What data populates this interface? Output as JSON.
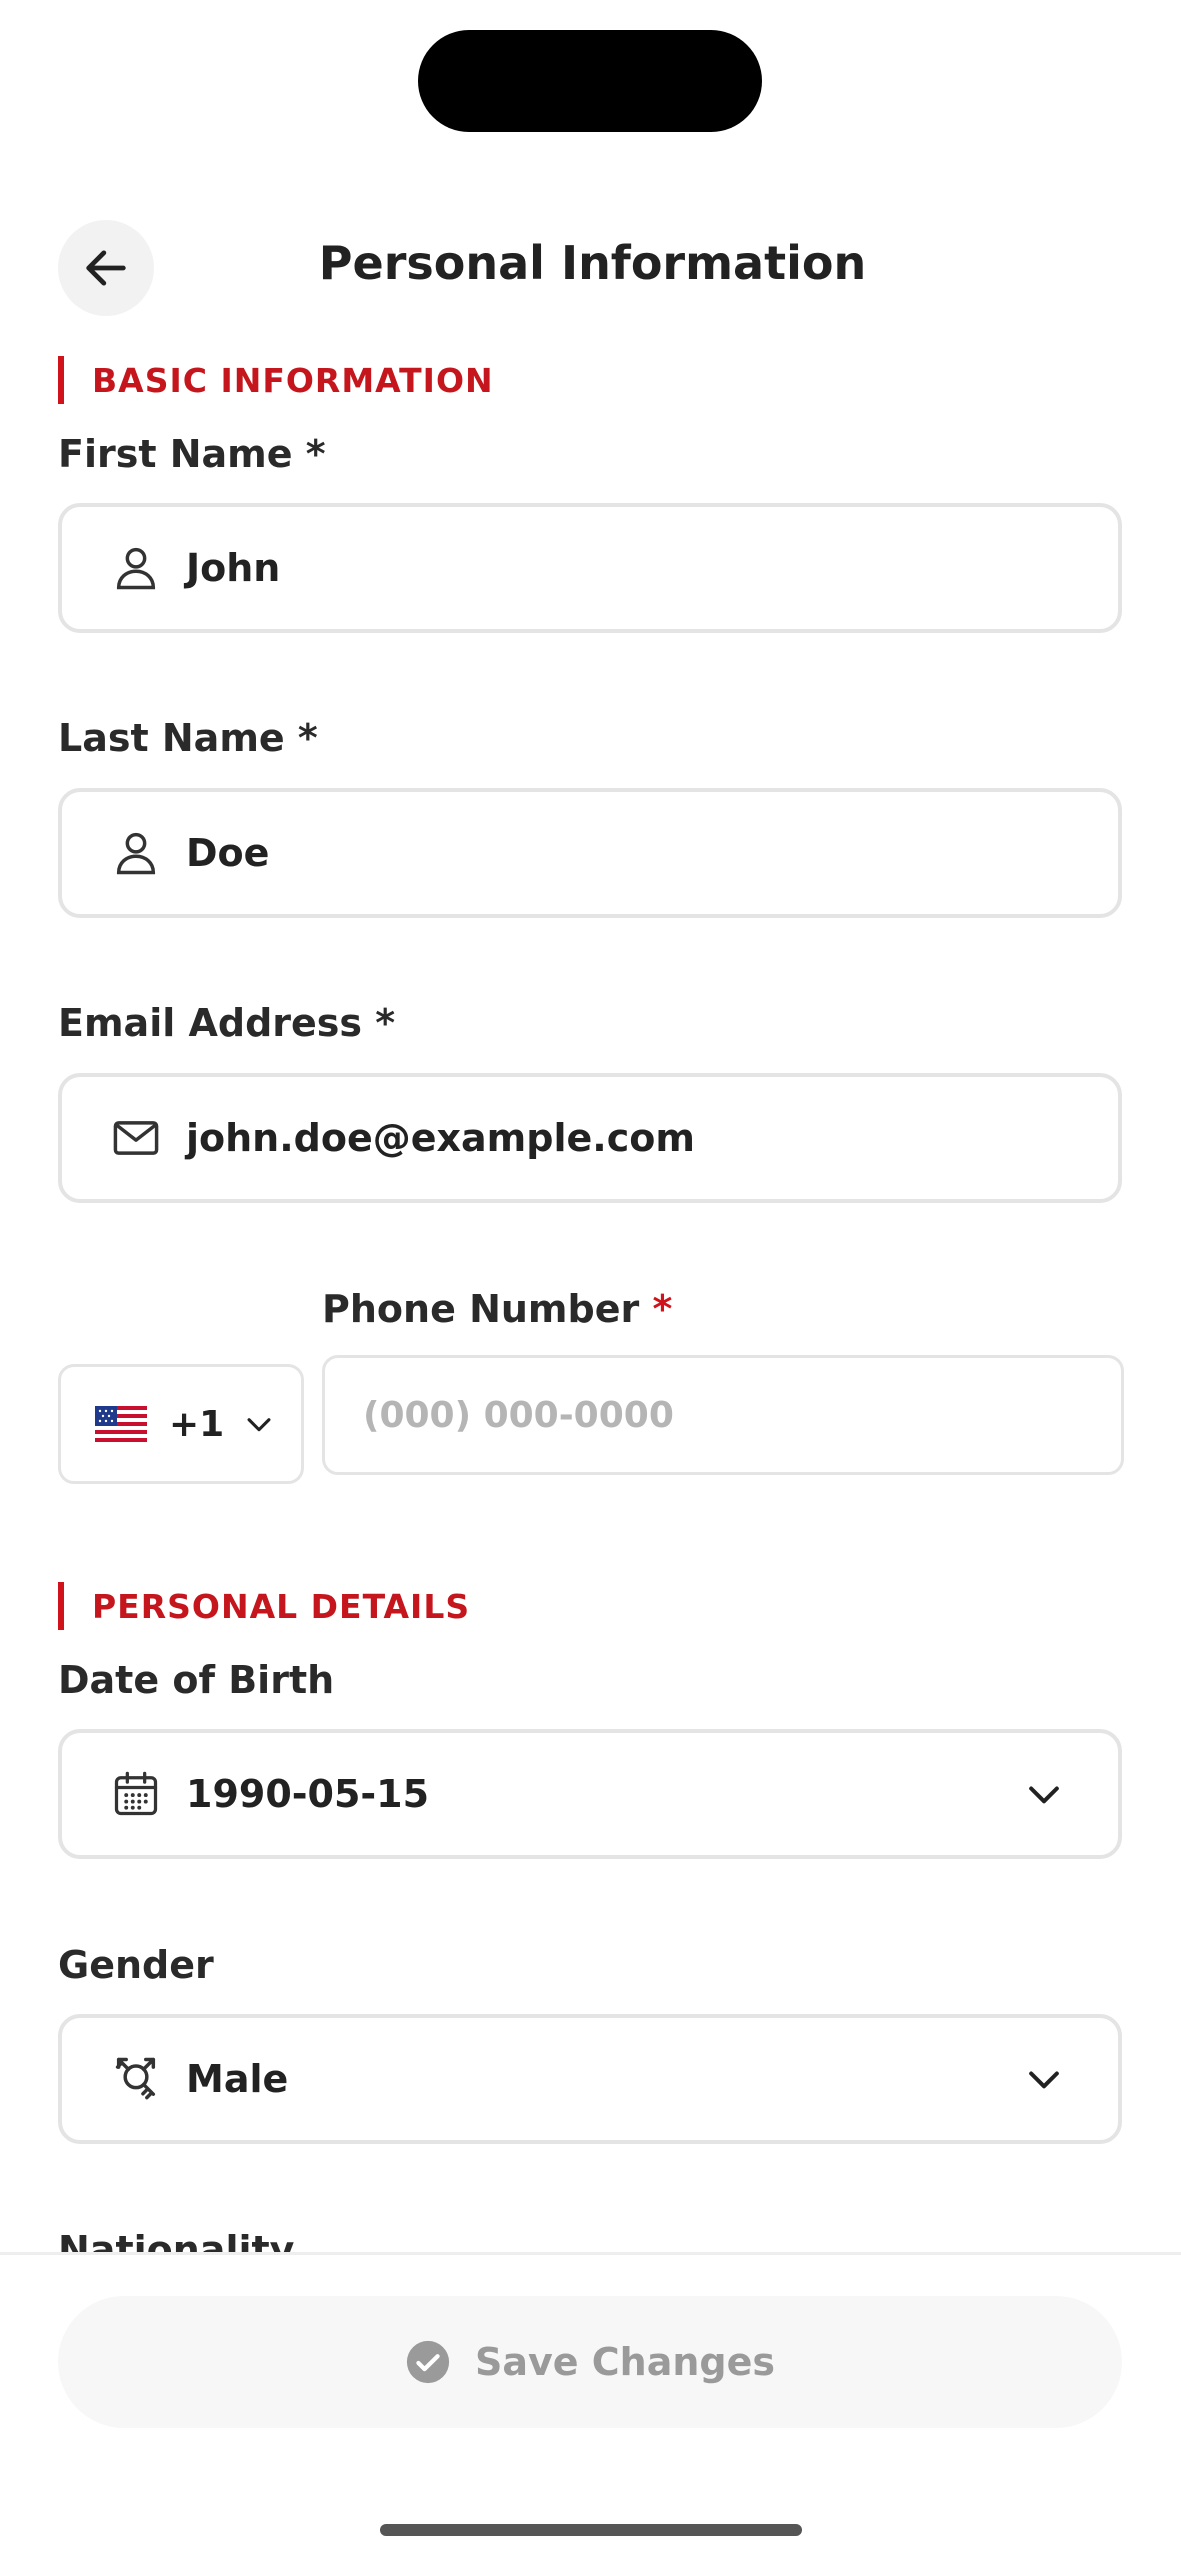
{
  "header": {
    "title": "Personal Information"
  },
  "sections": {
    "basic": "BASIC INFORMATION",
    "personal": "PERSONAL DETAILS"
  },
  "fields": {
    "first_name": {
      "label": "First Name *",
      "value": "John",
      "icon": "person-icon"
    },
    "last_name": {
      "label": "Last Name *",
      "value": "Doe",
      "icon": "person-icon"
    },
    "email": {
      "label": "Email Address *",
      "value": "john.doe@example.com",
      "icon": "mail-icon"
    },
    "phone": {
      "label": "Phone Number",
      "required_mark": "*",
      "placeholder": "(000) 000-0000",
      "country_code": "+1",
      "country_flag": "us-flag-icon"
    },
    "dob": {
      "label": "Date of Birth",
      "value": "1990-05-15",
      "icon": "calendar-icon"
    },
    "gender": {
      "label": "Gender",
      "value": "Male",
      "icon": "gender-icon"
    },
    "nationality": {
      "label": "Nationality"
    }
  },
  "footer": {
    "save_label": "Save Changes"
  },
  "colors": {
    "accent": "#d0121b",
    "border": "#e4e4e4",
    "text": "#222222",
    "placeholder": "#b5b5b5",
    "disabled": "#9a9a9a"
  }
}
